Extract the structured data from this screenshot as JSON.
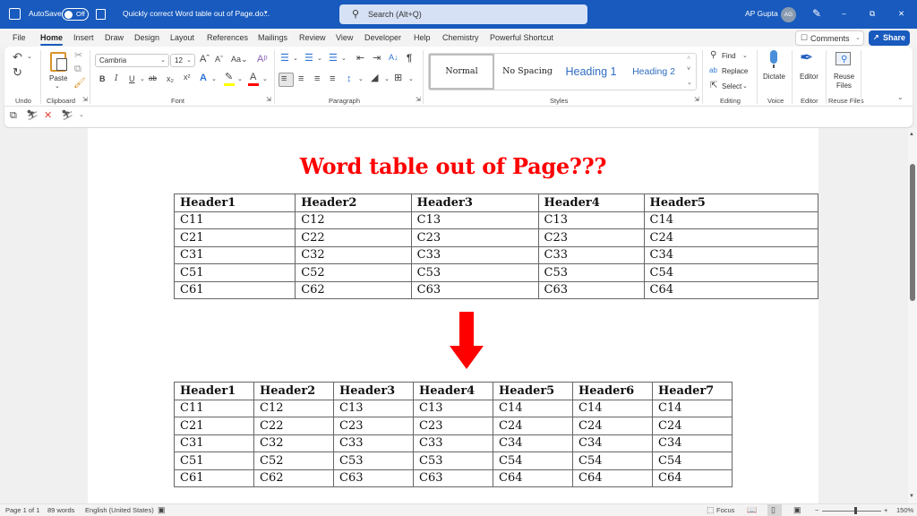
{
  "titlebar": {
    "autosave_label": "AutoSave",
    "autosave_state": "Off",
    "doc_title": "Quickly correct Word table out of Page.do...",
    "search_placeholder": "Search (Alt+Q)",
    "user_name": "AP Gupta",
    "user_initials": "AG",
    "minimize": "–",
    "restore": "⧉",
    "close": "✕"
  },
  "tabs": [
    "File",
    "Home",
    "Insert",
    "Draw",
    "Design",
    "Layout",
    "References",
    "Mailings",
    "Review",
    "View",
    "Developer",
    "Help",
    "Chemistry",
    "Powerful Shortcut"
  ],
  "active_tab": "Home",
  "comments_label": "Comments",
  "share_label": "Share",
  "ribbon": {
    "groups": {
      "undo": "Undo",
      "clipboard": "Clipboard",
      "font": "Font",
      "paragraph": "Paragraph",
      "styles": "Styles",
      "editing": "Editing",
      "voice": "Voice",
      "editor": "Editor",
      "reuse_files": "Reuse Files"
    },
    "paste_label": "Paste",
    "font_name": "Cambria",
    "font_size": "12",
    "styles": [
      "Normal",
      "No Spacing",
      "Heading 1",
      "Heading 2"
    ],
    "selected_style": "Normal",
    "find_label": "Find",
    "replace_label": "Replace",
    "select_label": "Select",
    "dictate_label": "Dictate",
    "editor_label": "Editor",
    "reuse_files_label_1": "Reuse",
    "reuse_files_label_2": "Files",
    "colors": {
      "highlight": "#ffff00",
      "font_color": "#ff0000"
    }
  },
  "document": {
    "title": "Word table out of Page???",
    "title_color": "#ff0000",
    "arrow_color": "#ff0000",
    "table_top": {
      "headers": [
        "Header1",
        "Header2",
        "Header3",
        "Header4",
        "Header5"
      ],
      "rows": [
        [
          "C11",
          "C12",
          "C13",
          "C13",
          "C14"
        ],
        [
          "C21",
          "C22",
          "C23",
          "C23",
          "C24"
        ],
        [
          "C31",
          "C32",
          "C33",
          "C33",
          "C34"
        ],
        [
          "C51",
          "C52",
          "C53",
          "C53",
          "C54"
        ],
        [
          "C61",
          "C62",
          "C63",
          "C63",
          "C64"
        ]
      ]
    },
    "table_bottom": {
      "headers": [
        "Header1",
        "Header2",
        "Header3",
        "Header4",
        "Header5",
        "Header6",
        "Header7"
      ],
      "rows": [
        [
          "C11",
          "C12",
          "C13",
          "C13",
          "C14",
          "C14",
          "C14"
        ],
        [
          "C21",
          "C22",
          "C23",
          "C23",
          "C24",
          "C24",
          "C24"
        ],
        [
          "C31",
          "C32",
          "C33",
          "C33",
          "C34",
          "C34",
          "C34"
        ],
        [
          "C51",
          "C52",
          "C53",
          "C53",
          "C54",
          "C54",
          "C54"
        ],
        [
          "C61",
          "C62",
          "C63",
          "C63",
          "C64",
          "C64",
          "C64"
        ]
      ]
    }
  },
  "status": {
    "page": "Page 1 of 1",
    "words": "89 words",
    "language": "English (United States)",
    "focus": "Focus",
    "zoom": "150%",
    "zoom_minus": "−",
    "zoom_plus": "+"
  }
}
